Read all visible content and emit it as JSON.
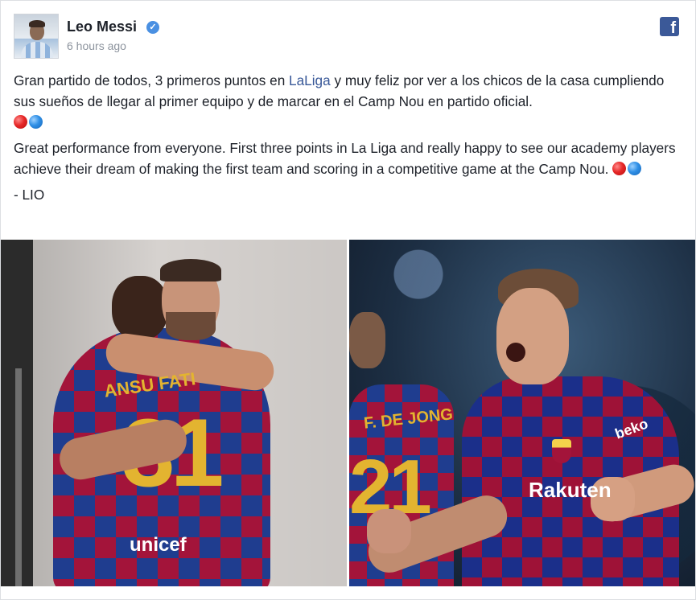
{
  "post": {
    "author_name": "Leo Messi",
    "verified_symbol": "✓",
    "timestamp": "6 hours ago",
    "network_icon": "facebook-icon",
    "network_letter": "f",
    "text": {
      "spanish_before_tag": "Gran partido de todos, 3 primeros puntos en ",
      "spanish_tag": "LaLiga",
      "spanish_after_tag": " y muy feliz por ver a los chicos de la casa cumpliendo sus sueños de llegar al primer equipo y de marcar en el Camp Nou en partido oficial.",
      "english": "Great performance from everyone. First three points in La Liga and really happy to see our academy players achieve their dream of making the first team and scoring in a competitive game at the Camp Nou.",
      "signature": "- LIO"
    },
    "emoji_colors": {
      "red": "#e62828",
      "blue": "#2f8fe6"
    }
  },
  "photos": {
    "left": {
      "shirt_name": "ANSU FATI",
      "shirt_number": "31",
      "sponsor": "unicef"
    },
    "right": {
      "left_player_name": "F. DE JONG",
      "left_player_number": "21",
      "sponsor": "Rakuten",
      "sleeve_sponsor": "beko"
    }
  },
  "colors": {
    "link": "#385898",
    "facebook_brand": "#3b5998",
    "verified_badge": "#4a90e2",
    "muted_text": "#8d949e"
  }
}
